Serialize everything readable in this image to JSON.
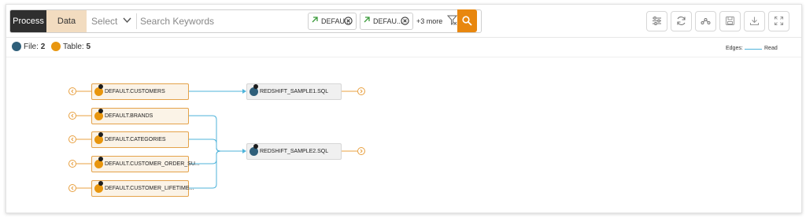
{
  "toolbar": {
    "mode_tabs": [
      {
        "label": "Process"
      },
      {
        "label": "Data"
      }
    ],
    "select_label": "Select",
    "search_placeholder": "Search Keywords",
    "chips": [
      {
        "label": "DEFAU..."
      },
      {
        "label": "DEFAU..."
      }
    ],
    "more_label": "+3 more"
  },
  "counts": {
    "file": {
      "label": "File:",
      "value": "2"
    },
    "table": {
      "label": "Table:",
      "value": "5"
    }
  },
  "legend": {
    "title": "Edges:",
    "read_label": "Read"
  },
  "nodes": {
    "tables": [
      {
        "label": "DEFAULT.CUSTOMERS"
      },
      {
        "label": "DEFAULT.BRANDS"
      },
      {
        "label": "DEFAULT.CATEGORIES"
      },
      {
        "label": "DEFAULT.CUSTOMER_ORDER_SU..."
      },
      {
        "label": "DEFAULT.CUSTOMER_LIFETIME..."
      }
    ],
    "files": [
      {
        "label": "REDSHIFT_SAMPLE1.SQL"
      },
      {
        "label": "REDSHIFT_SAMPLE2.SQL"
      }
    ]
  },
  "colors": {
    "accent": "#e8870f",
    "edge_read": "#4fb3da",
    "file_icon": "#2f5f7a",
    "table_icon": "#e8960f"
  },
  "icons": [
    "leaf-icon",
    "clear-circle-icon",
    "chevron-down-icon",
    "clear-filter-icon",
    "search-icon",
    "sliders-icon",
    "refresh-icon",
    "share-icon",
    "save-icon",
    "download-icon",
    "fullscreen-icon"
  ]
}
